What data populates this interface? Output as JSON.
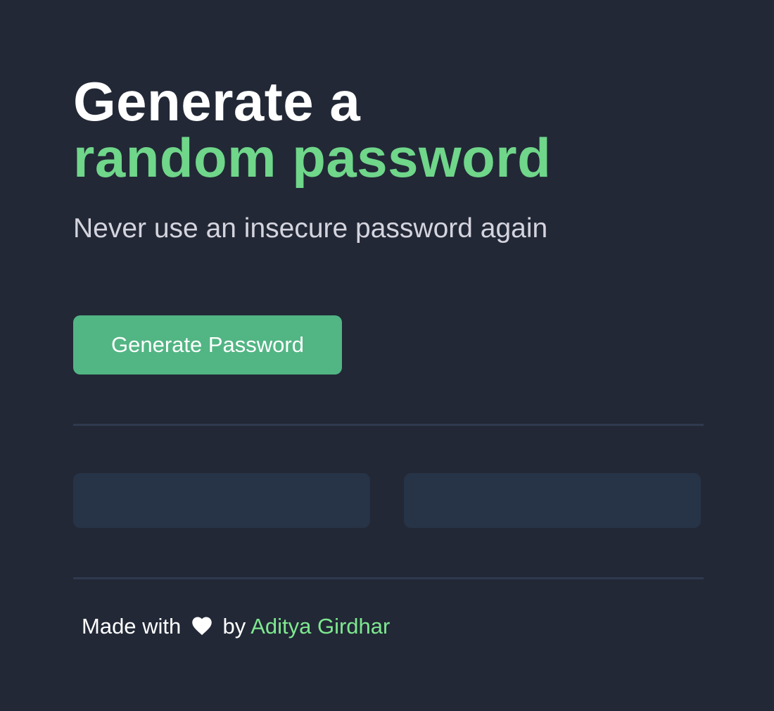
{
  "heading": {
    "line1": "Generate a",
    "line2": "random password"
  },
  "subtitle": "Never use an insecure password again",
  "generate_button": {
    "label": "Generate Password"
  },
  "password_outputs": [
    {
      "value": ""
    },
    {
      "value": ""
    }
  ],
  "footer": {
    "prefix": "Made with",
    "icon": "heart-icon",
    "by": "by",
    "author": "Aditya Girdhar"
  },
  "colors": {
    "background": "#222836",
    "accent_green": "#6FD68A",
    "button": "#52B584",
    "output_box": "#273346",
    "divider": "#2F3A4F",
    "link": "#7EE88F"
  }
}
